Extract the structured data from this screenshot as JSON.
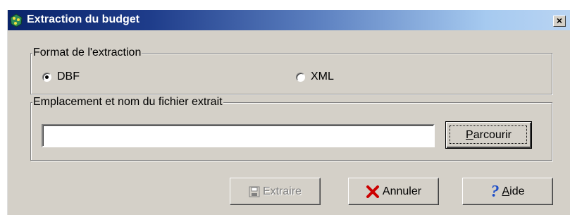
{
  "window": {
    "title": "Extraction du budget",
    "close_glyph": "×"
  },
  "format_group": {
    "legend": "Format de l'extraction",
    "options": [
      {
        "label": "DBF",
        "selected": true
      },
      {
        "label": "XML",
        "selected": false
      }
    ]
  },
  "file_group": {
    "legend": "Emplacement et nom du fichier extrait",
    "path_value": ""
  },
  "buttons": {
    "browse": {
      "label_u": "P",
      "label_rest": "arcourir"
    },
    "extract": {
      "label": "Extraire",
      "enabled": false,
      "icon": "floppy-disk-icon"
    },
    "cancel": {
      "label": "Annuler",
      "icon": "red-x-icon"
    },
    "help": {
      "label_u": "A",
      "label_rest": "ide",
      "icon": "question-mark-icon"
    }
  },
  "colors": {
    "face": "#d4d0c8",
    "title_start": "#0a246a",
    "title_end": "#a6caf0",
    "cancel_icon": "#cc0000",
    "help_icon": "#1e4ec8"
  }
}
